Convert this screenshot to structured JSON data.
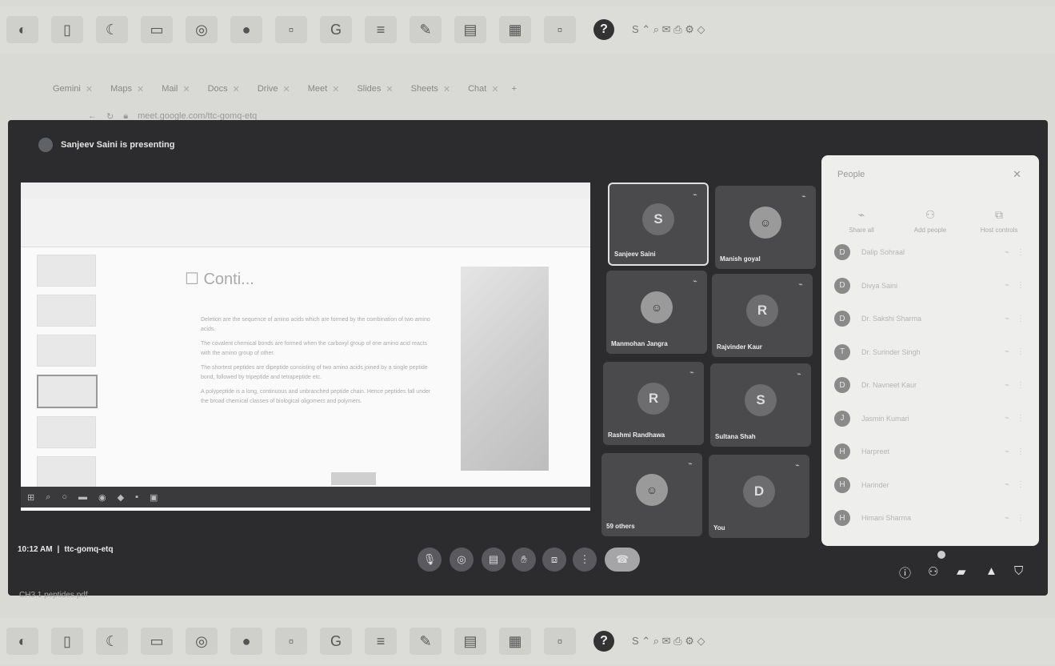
{
  "taskbar": {
    "icons": [
      "windows-icon",
      "word-icon",
      "moon-icon",
      "folder-icon",
      "chrome-icon",
      "media-icon",
      "blank-icon",
      "google-icon",
      "notes-icon",
      "paint-icon",
      "document-icon",
      "app-icon",
      "blank2-icon",
      "help-icon"
    ],
    "help_label": "?",
    "tray_text": "S ⌃ ⌕ ✉ ⎙ ⚙ ◇"
  },
  "browser": {
    "tabs": [
      {
        "label": "Gemini"
      },
      {
        "label": "Maps"
      },
      {
        "label": "Mail"
      },
      {
        "label": "Docs"
      },
      {
        "label": "Drive"
      },
      {
        "label": "Meet"
      },
      {
        "label": "Slides"
      },
      {
        "label": "Sheets"
      },
      {
        "label": "Chat"
      }
    ],
    "address": "meet.google.com/ttc-gomq-etq"
  },
  "meet": {
    "presenting_text": "Sanjeev Saini is presenting",
    "slide": {
      "title": "☐ Conti...",
      "bullets": [
        "Deletion are the sequence of amino acids which are formed by the combination of two amino acids.",
        "The covalent chemical bonds are formed when the carboxyl group of one amino acid reacts with the amino group of other.",
        "The shortest peptides are dipeptide consisting of two amino acids joined by a single peptide bond, followed by tripeptide and tetrapeptide etc.",
        "A polypeptide is a long, continuous and unbranched peptide chain. Hence peptides fall under the broad chemical classes of biological oligomers and polymers."
      ]
    },
    "tiles": [
      {
        "name": "Sanjeev Saini",
        "initial": "S",
        "photo": false,
        "active": true
      },
      {
        "name": "Manish goyal",
        "initial": "",
        "photo": true,
        "active": false
      },
      {
        "name": "Manmohan Jangra",
        "initial": "",
        "photo": true,
        "active": false
      },
      {
        "name": "Rajvinder Kaur",
        "initial": "R",
        "photo": false,
        "active": false
      },
      {
        "name": "Rashmi Randhawa",
        "initial": "R",
        "photo": false,
        "active": false
      },
      {
        "name": "Sultana Shah",
        "initial": "S",
        "photo": false,
        "active": false
      },
      {
        "name": "59 others",
        "initial": "",
        "photo": true,
        "active": false
      },
      {
        "name": "You",
        "initial": "D",
        "photo": false,
        "active": false
      }
    ],
    "people_panel": {
      "title": "People",
      "actions": [
        "Share all",
        "Add people",
        "Host controls"
      ],
      "participants": [
        {
          "initial": "D",
          "name": "Dalip Sohraal"
        },
        {
          "initial": "D",
          "name": "Divya Saini"
        },
        {
          "initial": "D",
          "name": "Dr. Sakshi Sharma"
        },
        {
          "initial": "T",
          "name": "Dr. Surinder Singh"
        },
        {
          "initial": "D",
          "name": "Dr. Navneet Kaur"
        },
        {
          "initial": "J",
          "name": "Jasmin Kumari"
        },
        {
          "initial": "H",
          "name": "Harpreet"
        },
        {
          "initial": "H",
          "name": "Harinder"
        },
        {
          "initial": "H",
          "name": "Himani Sharma"
        }
      ]
    },
    "time": "10:12 AM",
    "meeting_code": "ttc-gomq-etq",
    "divider": "|"
  },
  "download_bar": {
    "text": "CH3.1 peptides.pdf"
  }
}
